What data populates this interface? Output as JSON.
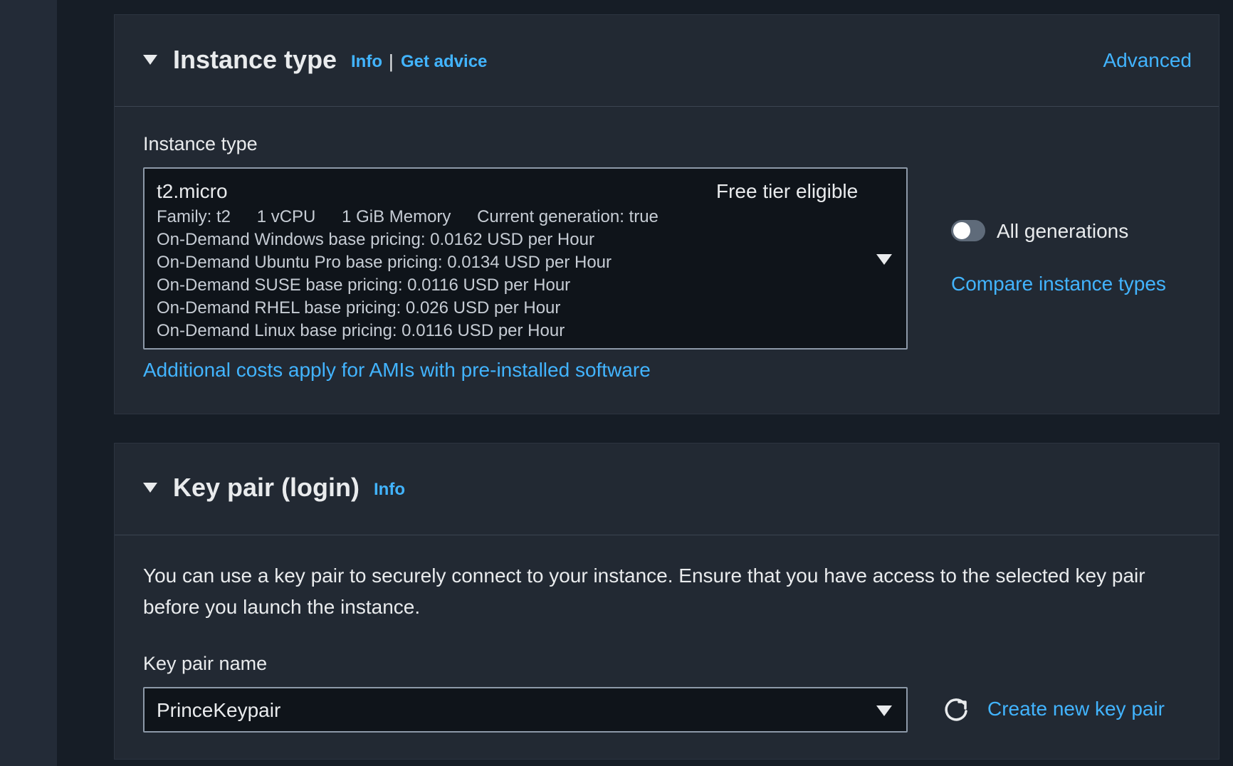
{
  "instance_type_section": {
    "title": "Instance type",
    "info_link": "Info",
    "separator": "|",
    "get_advice_link": "Get advice",
    "advanced_link": "Advanced",
    "field_label": "Instance type",
    "selected": {
      "name": "t2.micro",
      "badge": "Free tier eligible",
      "family": "Family: t2",
      "vcpu": "1 vCPU",
      "memory": "1 GiB Memory",
      "current_generation": "Current generation: true",
      "pricing_lines": [
        "On-Demand Windows base pricing: 0.0162 USD per Hour",
        "On-Demand Ubuntu Pro base pricing: 0.0134 USD per Hour",
        "On-Demand SUSE base pricing: 0.0116 USD per Hour",
        "On-Demand RHEL base pricing: 0.026 USD per Hour",
        "On-Demand Linux base pricing: 0.0116 USD per Hour"
      ]
    },
    "all_generations_label": "All generations",
    "all_generations_enabled": false,
    "compare_link": "Compare instance types",
    "additional_costs_link": "Additional costs apply for AMIs with pre-installed software"
  },
  "key_pair_section": {
    "title": "Key pair (login)",
    "info_link": "Info",
    "description": "You can use a key pair to securely connect to your instance. Ensure that you have access to the selected key pair before you launch the instance.",
    "field_label": "Key pair name",
    "selected_value": "PrinceKeypair",
    "create_link": "Create new key pair"
  },
  "colors": {
    "link": "#42b4ff",
    "panel": "#222933",
    "text": "#e9ebed"
  }
}
